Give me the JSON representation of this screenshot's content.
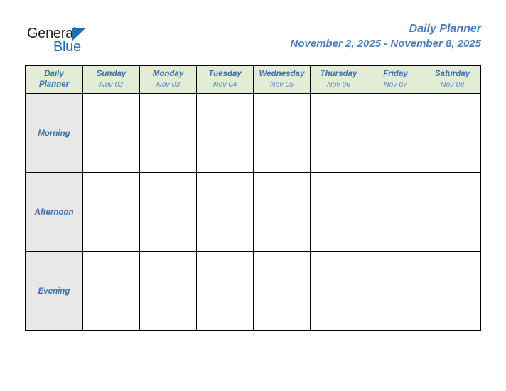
{
  "logo": {
    "text_primary": "General",
    "text_secondary": "Blue",
    "triangle_icon": "triangle-icon",
    "color_primary": "#231f20",
    "color_secondary": "#1f6fb5"
  },
  "header": {
    "title": "Daily Planner",
    "date_range": "November 2, 2025 - November 8, 2025",
    "accent_color": "#4a7ebb"
  },
  "table": {
    "corner_label_line1": "Daily",
    "corner_label_line2": "Planner",
    "header_bg": "#e3ecd4",
    "slot_bg": "#e8e8e8",
    "border_color": "#000000",
    "columns": [
      {
        "day": "Sunday",
        "date": "Nov 02"
      },
      {
        "day": "Monday",
        "date": "Nov 03"
      },
      {
        "day": "Tuesday",
        "date": "Nov 04"
      },
      {
        "day": "Wednesday",
        "date": "Nov 05"
      },
      {
        "day": "Thursday",
        "date": "Nov 06"
      },
      {
        "day": "Friday",
        "date": "Nov 07"
      },
      {
        "day": "Saturday",
        "date": "Nov 08"
      }
    ],
    "rows": [
      {
        "label": "Morning",
        "entries": [
          "",
          "",
          "",
          "",
          "",
          "",
          ""
        ]
      },
      {
        "label": "Afternoon",
        "entries": [
          "",
          "",
          "",
          "",
          "",
          "",
          ""
        ]
      },
      {
        "label": "Evening",
        "entries": [
          "",
          "",
          "",
          "",
          "",
          "",
          ""
        ]
      }
    ]
  }
}
